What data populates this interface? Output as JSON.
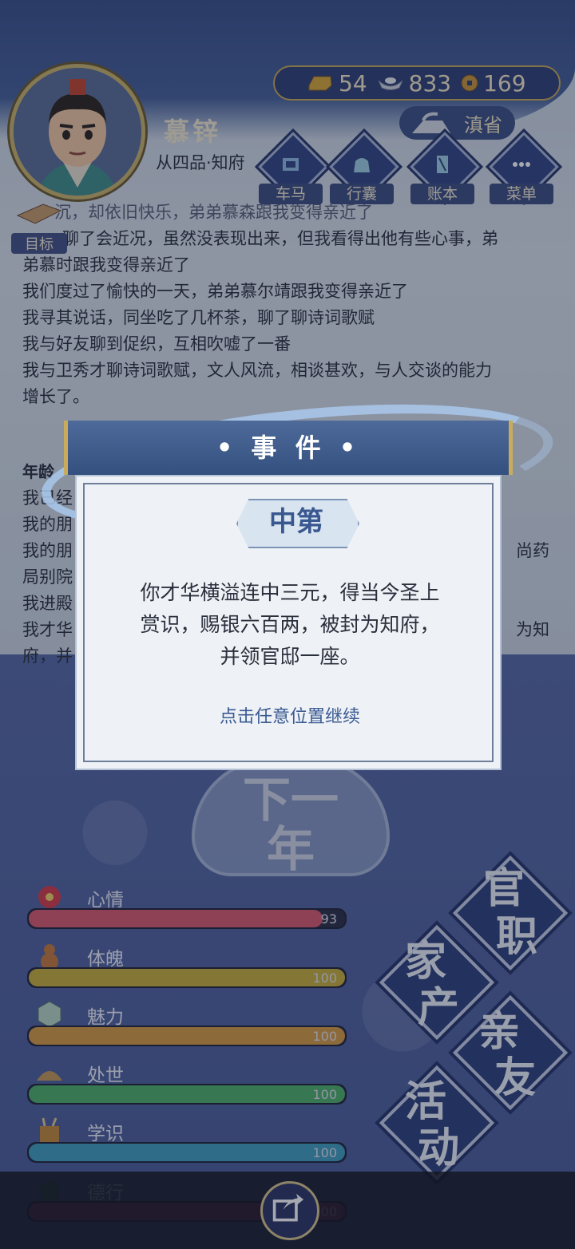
{
  "player": {
    "name": "慕锌",
    "rank": "从四品·知府",
    "location": "滇省"
  },
  "currency": {
    "gold": "54",
    "silver": "833",
    "coin": "169"
  },
  "nav": {
    "carriage": "车马",
    "bag": "行囊",
    "ledger": "账本",
    "menu": "菜单",
    "target": "目标"
  },
  "log": {
    "line0": "沉，却依旧快乐，弟弟慕森跟我变得亲近了",
    "line1": "聊了会近况，虽然没表现出来，但我看得出他有些心事，弟",
    "line2": "弟慕时跟我变得亲近了",
    "line3": "我们度过了愉快的一天，弟弟慕尔靖跟我变得亲近了",
    "line4": "我寻其说话，同坐吃了几杯茶，聊了聊诗词歌赋",
    "line5": "我与好友聊到促织，互相吹嘘了一番",
    "line6": "我与卫秀才聊诗词歌赋，文人风流，相谈甚欢，与人交谈的能力",
    "line7": "增长了。",
    "year_head": "年龄",
    "l2_0": "我已经",
    "l2_1": "我的朋",
    "l2_2a": "我的朋",
    "l2_2b": "尚药",
    "l2_3": "局别院",
    "l2_4": "我进殿",
    "l2_5a": "我才华",
    "l2_5b": "为知",
    "l2_6": "府，并"
  },
  "modal": {
    "title": "• 事 件 •",
    "tag": "中第",
    "text1": "你才华横溢连中三元，得当今圣上",
    "text2": "赏识，赐银六百两，被封为知府，",
    "text3": "并领官邸一座。",
    "continue": "点击任意位置继续"
  },
  "next_year": {
    "top": "下一",
    "bottom": "年"
  },
  "stats": [
    {
      "name": "心情",
      "value": 93,
      "display": "93",
      "color": "#d9576f"
    },
    {
      "name": "体魄",
      "value": 100,
      "display": "100",
      "color": "#c9b13a"
    },
    {
      "name": "魅力",
      "value": 100,
      "display": "100",
      "color": "#d79b43"
    },
    {
      "name": "处世",
      "value": 100,
      "display": "100",
      "color": "#4cb06a"
    },
    {
      "name": "学识",
      "value": 100,
      "display": "100",
      "color": "#3f9fc0"
    },
    {
      "name": "德行",
      "value": 100,
      "display": "100",
      "color": "#b0487c"
    }
  ],
  "actions": {
    "official": {
      "a": "官",
      "b": "职"
    },
    "family": {
      "a": "家",
      "b": "产"
    },
    "friends": {
      "a": "亲",
      "b": "友"
    },
    "activity": {
      "a": "活",
      "b": "动"
    }
  },
  "icons": {
    "gold": "gold-ingot-icon",
    "silver": "silver-ingot-icon",
    "coin": "copper-coin-icon",
    "share": "share-icon"
  }
}
